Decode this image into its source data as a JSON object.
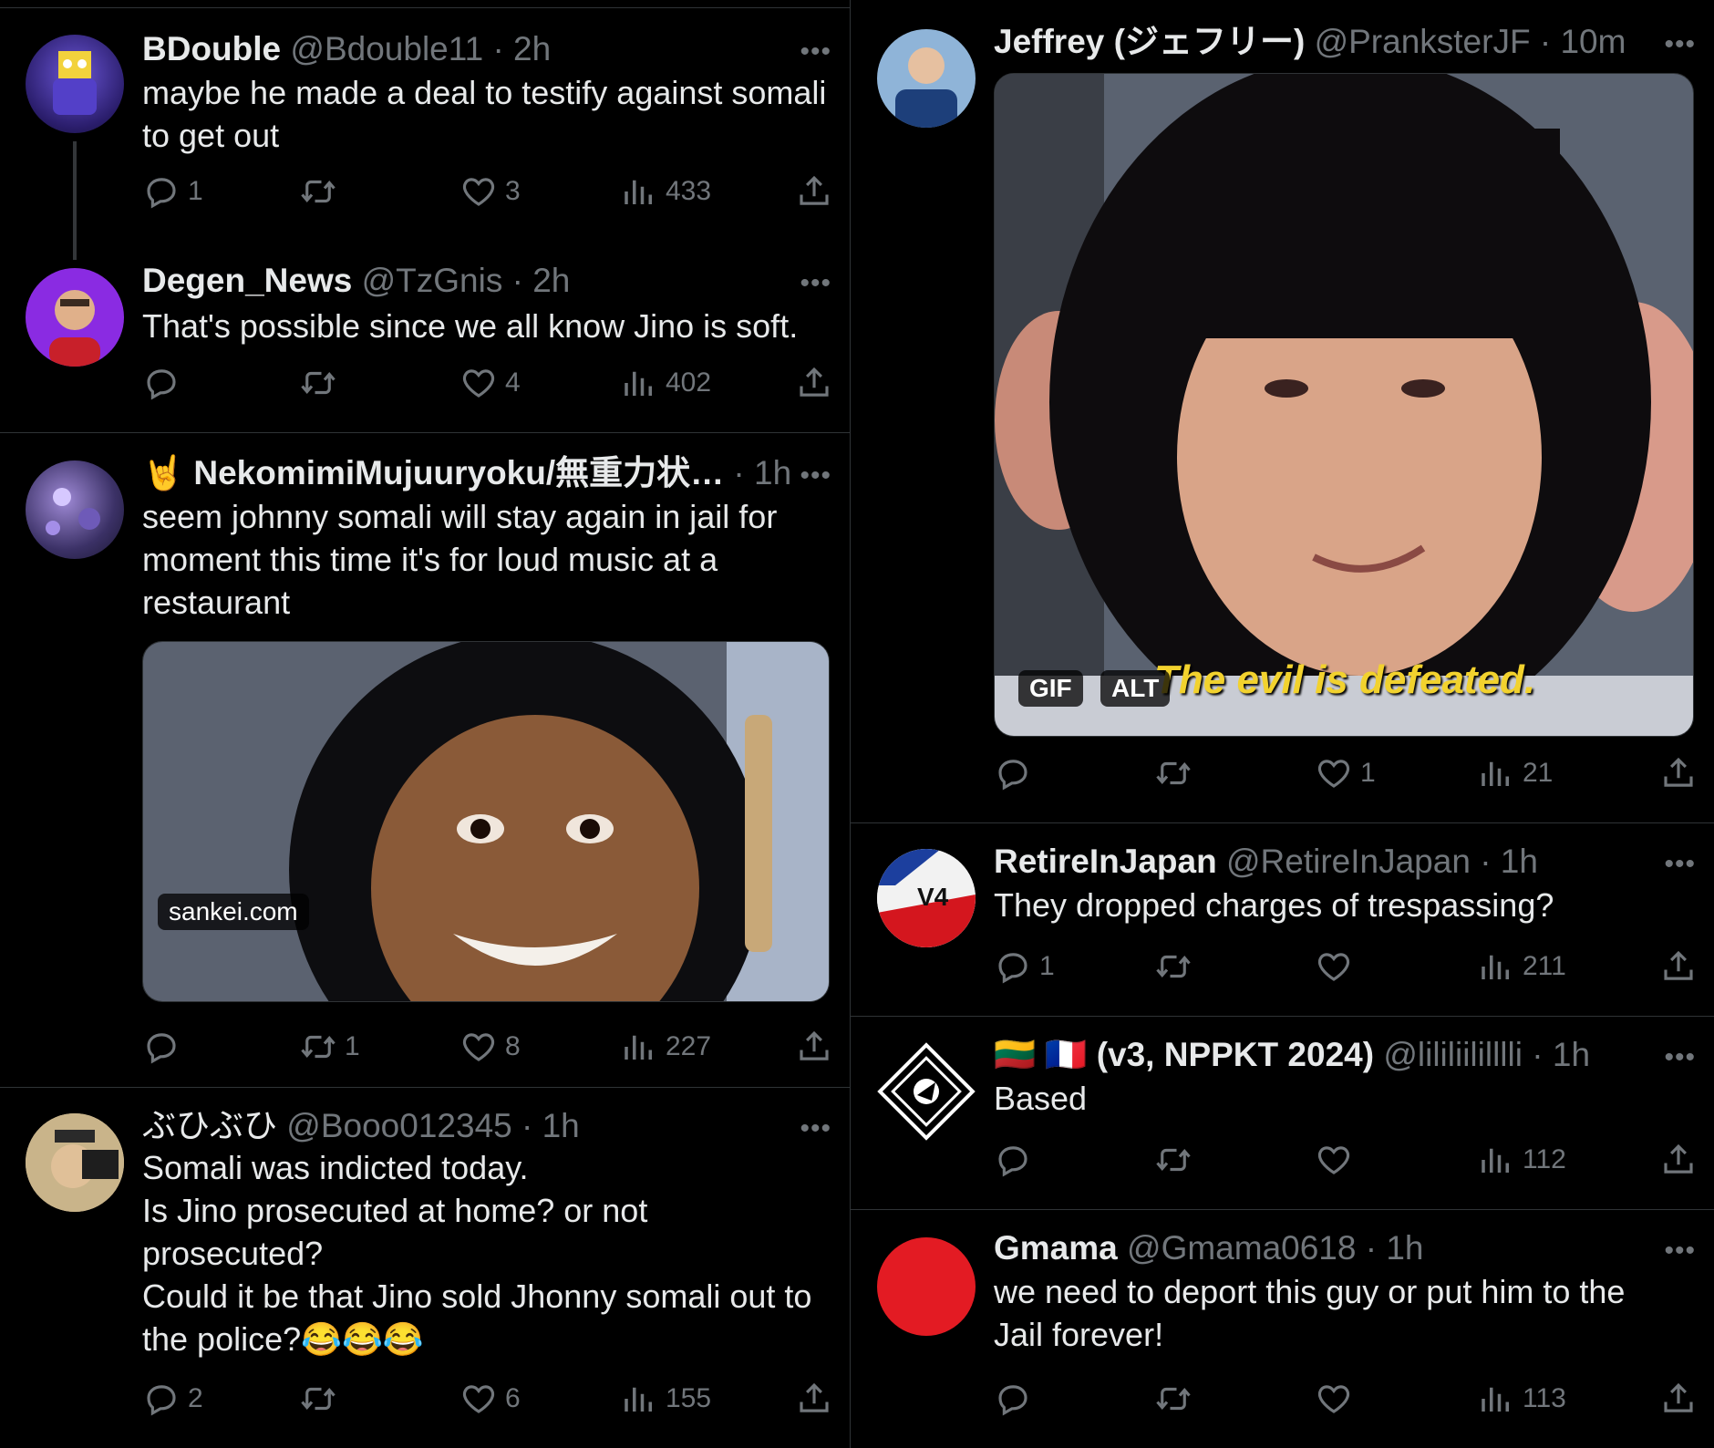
{
  "left": {
    "tweets": [
      {
        "name": "BDouble",
        "handle": "@Bdouble11",
        "time": "· 2h",
        "text": "maybe he made a deal to testify against somali\nto get out",
        "replies": "1",
        "retweets": "",
        "likes": "3",
        "views": "433"
      },
      {
        "name": "Degen_News",
        "handle": "@TzGnis",
        "time": "· 2h",
        "text": "That's possible since we all know Jino is soft.",
        "replies": "",
        "retweets": "",
        "likes": "4",
        "views": "402"
      },
      {
        "name": "🤘 NekomimiMujuuryoku/無重力状…",
        "handle": "",
        "time": "· 1h",
        "text": "seem johnny somali will stay again in jail for\nmoment this time it's for loud music at a\nrestaurant",
        "media_label": "sankei.com",
        "replies": "",
        "retweets": "1",
        "likes": "8",
        "views": "227"
      },
      {
        "name": "ぶひぶひ",
        "handle": "@Booo012345",
        "time": "· 1h",
        "text": "Somali was indicted today.\nIs Jino prosecuted at home? or not\nprosecuted?\nCould it be that Jino sold Jhonny somali out to\nthe police?😂😂😂",
        "replies": "2",
        "retweets": "",
        "likes": "6",
        "views": "155"
      }
    ]
  },
  "right": {
    "tweets": [
      {
        "name": "Jeffrey (ジェフリー)",
        "handle": "@PranksterJF",
        "time": "· 10m",
        "media_caption": "The evil is defeated.",
        "gif_label": "GIF",
        "alt_label": "ALT",
        "replies": "",
        "retweets": "",
        "likes": "1",
        "views": "21"
      },
      {
        "name": "RetireInJapan",
        "handle": "@RetireInJapan",
        "time": "· 1h",
        "text": "They dropped charges of trespassing?",
        "replies": "1",
        "retweets": "",
        "likes": "",
        "views": "211"
      },
      {
        "name": "🇱🇹 🇫🇷 (v3, NPPKT 2024)",
        "handle": "@lililiililllli",
        "time": "· 1h",
        "text": "Based",
        "replies": "",
        "retweets": "",
        "likes": "",
        "views": "112"
      },
      {
        "name": "Gmama",
        "handle": "@Gmama0618",
        "time": "· 1h",
        "text": "we need to deport this guy or put him to the\nJail forever!",
        "replies": "",
        "retweets": "",
        "likes": "",
        "views": "113"
      }
    ]
  },
  "ui": {
    "more_glyph": "•••"
  },
  "colors": {
    "background": "#000000",
    "text": "#e7e9ea",
    "muted": "#71767b",
    "divider": "#2f3336"
  }
}
